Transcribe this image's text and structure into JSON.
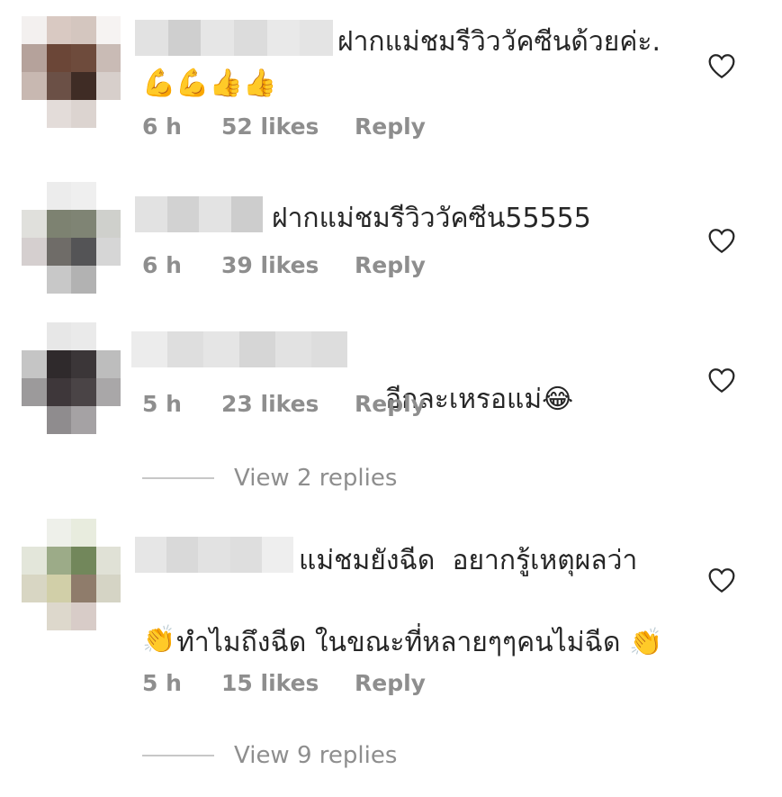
{
  "colors": {
    "text": "#262626",
    "meta": "#8e8e8e",
    "divider": "#c7c7c7"
  },
  "comments": [
    {
      "text": "ฝากแม่ชมรีวิววัคซีนด้วยค่ะ.",
      "emojis": "💪💪👍👍",
      "time": "6 h",
      "likes": "52 likes",
      "reply": "Reply",
      "icon": "heart-outline-icon"
    },
    {
      "text": "ฝากแม่ชมรีวิววัคซีน55555",
      "time": "6 h",
      "likes": "39 likes",
      "reply": "Reply",
      "icon": "heart-outline-icon"
    },
    {
      "text": "อีกละเหรอแม่",
      "emojis": "😂",
      "time": "5 h",
      "likes": "23 likes",
      "reply": "Reply",
      "icon": "heart-outline-icon",
      "view_replies": "View 2 replies"
    },
    {
      "text_line1": "แม่ชมยังฉีด  อยากรู้เหตุผลว่า",
      "text_line2": "ทำไมถึงฉีด ในขณะที่หลายๆๆคนไม่ฉีด",
      "emoji_inline": "👏",
      "emoji_line3": "👏",
      "time": "5 h",
      "likes": "15 likes",
      "reply": "Reply",
      "icon": "heart-outline-icon",
      "view_replies": "View 9 replies"
    }
  ]
}
